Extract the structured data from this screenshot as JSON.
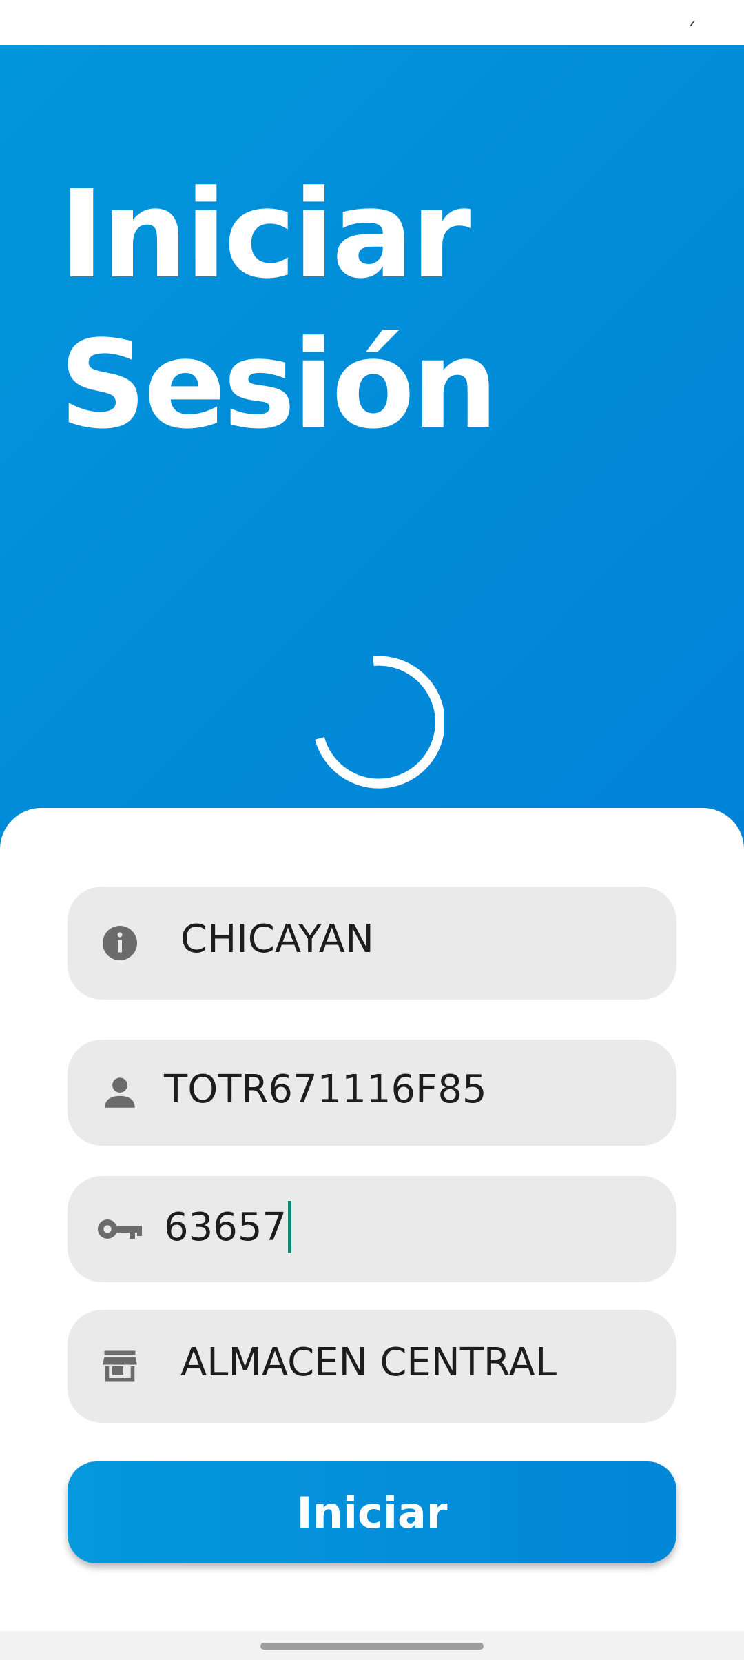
{
  "header": {
    "title_line1": "Iniciar",
    "title_line2": "Sesión"
  },
  "fields": {
    "company": {
      "value": "CHICAYAN",
      "icon": "info-icon"
    },
    "user": {
      "value": "TOTR671116F85",
      "icon": "person-icon"
    },
    "password": {
      "value": "63657",
      "icon": "key-icon"
    },
    "warehouse": {
      "value": "ALMACEN CENTRAL",
      "icon": "store-icon"
    }
  },
  "login_button": {
    "label": "Iniciar"
  },
  "colors": {
    "primary": "#0296db",
    "field_background": "#eaeaea",
    "caret": "#0e8a72",
    "icon": "#6b6b6b"
  }
}
